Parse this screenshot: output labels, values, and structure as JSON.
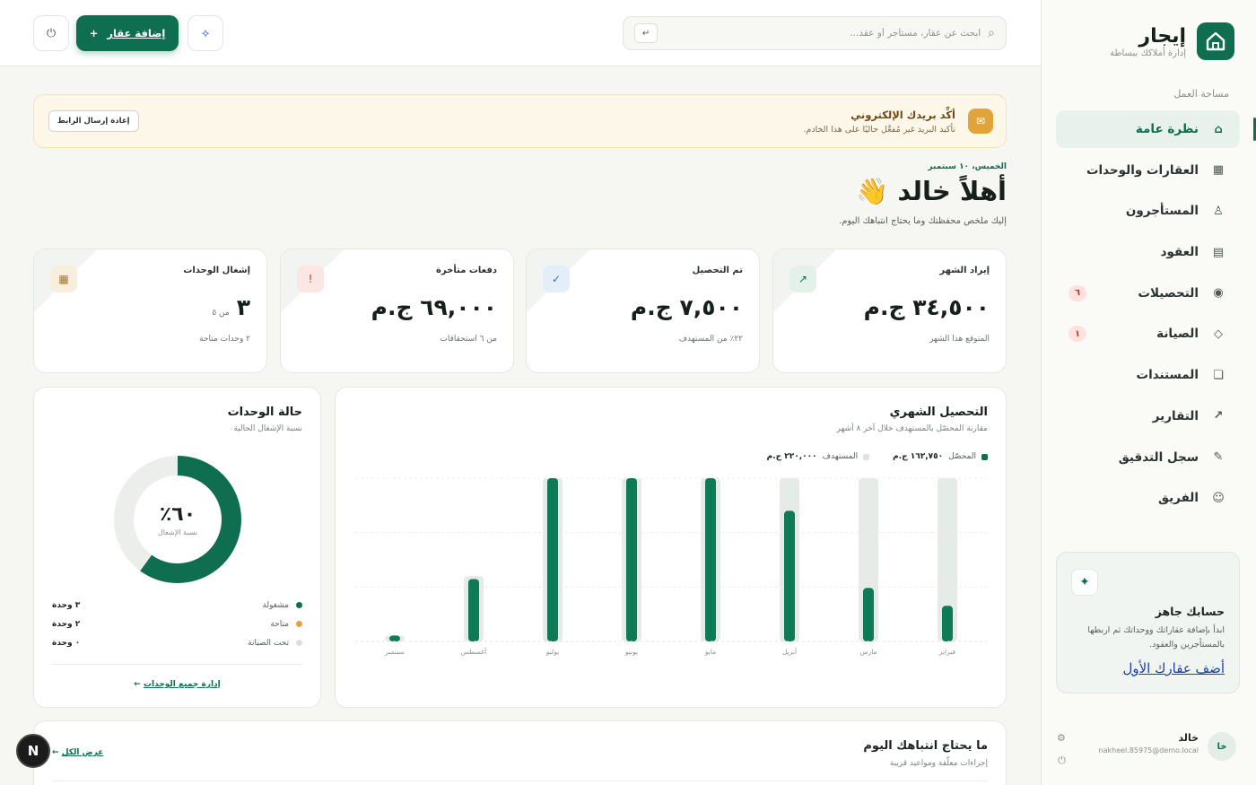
{
  "app": {
    "name": "إيجار",
    "tagline": "إدارة أملاكك ببساطة"
  },
  "sidebar": {
    "section_label": "مساحة العمل",
    "items": [
      {
        "label": "نظرة عامة",
        "icon": "home-icon",
        "glyph": "⌂",
        "badge": ""
      },
      {
        "label": "العقارات والوحدات",
        "icon": "building-icon",
        "glyph": "▦",
        "badge": ""
      },
      {
        "label": "المستأجرون",
        "icon": "user-icon",
        "glyph": "♙",
        "badge": ""
      },
      {
        "label": "العقود",
        "icon": "document-icon",
        "glyph": "▤",
        "badge": ""
      },
      {
        "label": "التحصيلات",
        "icon": "collection-icon",
        "glyph": "◉",
        "badge": "٦"
      },
      {
        "label": "الصيانة",
        "icon": "wrench-icon",
        "glyph": "◇",
        "badge": "١"
      },
      {
        "label": "المستندات",
        "icon": "folder-icon",
        "glyph": "❏",
        "badge": ""
      },
      {
        "label": "التقارير",
        "icon": "trend-icon",
        "glyph": "↗",
        "badge": ""
      },
      {
        "label": "سجل التدقيق",
        "icon": "pen-icon",
        "glyph": "✎",
        "badge": ""
      },
      {
        "label": "الفريق",
        "icon": "team-icon",
        "glyph": "☺",
        "badge": ""
      }
    ],
    "ready_card": {
      "title": "حسابك جاهز",
      "text": "ابدأ بإضافة عقاراتك ووحداتك ثم اربطها بالمستأجرين والعقود.",
      "link": "أضف عقارك الأول"
    },
    "user": {
      "initials": "خا",
      "name": "خالد",
      "email": "nakheel.85975@demo.local"
    }
  },
  "topbar": {
    "search_placeholder": "ابحث عن عقار، مستأجر أو عقد...",
    "search_shortcut": "↵",
    "add_button": "إضافة عقار",
    "add_button_icon": "+"
  },
  "alert": {
    "title": "أكِّد بريدك الإلكتروني",
    "text": "تأكيد البريد غير مُفعَّل حاليًا على هذا الخادم.",
    "button": "إعادة إرسال الرابط"
  },
  "greeting": {
    "date": "الخميس، ١٠ سبتمبر",
    "title": "أهلاً خالد 👋",
    "subtitle": "إليك ملخص محفظتك وما يحتاج انتباهك اليوم."
  },
  "stats": [
    {
      "label": "إيراد الشهر",
      "value": "٣٤,٥٠٠ ج.م",
      "suffix": "",
      "foot": "المتوقع هذا الشهر",
      "icon": "trend-up-icon",
      "glyph": "↗",
      "color": "#0f6e4f",
      "bg": "#e4f1ea"
    },
    {
      "label": "تم التحصيل",
      "value": "٧,٥٠٠ ج.م",
      "suffix": "",
      "foot": "٢٢٪ من المستهدف",
      "icon": "check-icon",
      "glyph": "✓",
      "color": "#2f6fb0",
      "bg": "#e4eef8"
    },
    {
      "label": "دفعات متأخرة",
      "value": "٦٩,٠٠٠ ج.م",
      "suffix": "",
      "foot": "من ٦ استحقاقات",
      "icon": "alert-icon",
      "glyph": "!",
      "color": "#c0392b",
      "bg": "#fbe6e3"
    },
    {
      "label": "إشغال الوحدات",
      "value": "٣",
      "suffix": "من ٥",
      "foot": "٢ وحدات متاحة",
      "icon": "grid-icon",
      "glyph": "▦",
      "color": "#a07a22",
      "bg": "#f7eedb"
    }
  ],
  "units": {
    "title": "حالة الوحدات",
    "subtitle": "نسبة الإشغال الحالية",
    "occupancy_fraction": 0.6,
    "pct_label": "٦٠٪",
    "pct_caption": "نسبة الإشغال",
    "legend": [
      {
        "name": "مشغولة",
        "value": "٣ وحدة",
        "color": "#0f6e4f"
      },
      {
        "name": "متاحة",
        "value": "٢ وحدة",
        "color": "#e0a43a"
      },
      {
        "name": "تحت الصيانة",
        "value": "٠ وحدة",
        "color": "#dcdedb"
      }
    ],
    "manage_link": "إدارة جميع الوحدات",
    "manage_arrow": "←"
  },
  "monthly": {
    "title": "التحصيل الشهري",
    "subtitle": "مقارنة المحصّل بالمستهدف خلال آخر ٨ أشهر",
    "legend": [
      {
        "name": "المحصّل",
        "value": "١٦٢,٧٥٠ ج.م",
        "color": "#0f6e4f"
      },
      {
        "name": "المستهدف",
        "value": "٢٢٠,٠٠٠ ج.م",
        "color": "#dfe2de"
      }
    ]
  },
  "chart_data": {
    "type": "bar",
    "categories": [
      "فبراير",
      "مارس",
      "أبريل",
      "مايو",
      "يونيو",
      "يوليو",
      "أغسطس",
      "سبتمبر"
    ],
    "series": [
      {
        "name": "المستهدف",
        "values": [
          27500,
          27500,
          27500,
          27500,
          27500,
          27500,
          11000,
          1000
        ]
      },
      {
        "name": "المحصّل",
        "values": [
          6000,
          9000,
          22000,
          27500,
          27500,
          27500,
          10500,
          1000
        ]
      }
    ],
    "ylim": [
      0,
      27500
    ],
    "grid": true,
    "legend": "top-right"
  },
  "attention": {
    "title": "ما يحتاج انتباهك اليوم",
    "subtitle": "إجراءات معلّقة ومواعيد قريبة",
    "link": "عرض الكل",
    "link_arrow": "←"
  },
  "badge": {
    "letter": "N"
  }
}
